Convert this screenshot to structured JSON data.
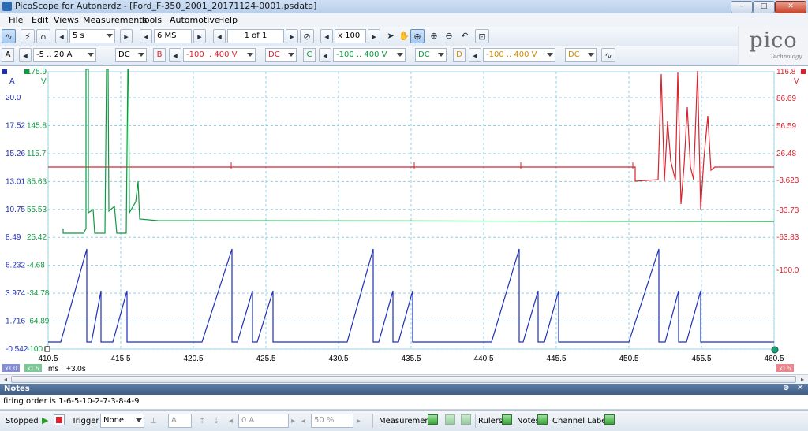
{
  "window": {
    "title": "PicoScope for Autonerdz - [Ford_F-350_2001_20171124-0001.psdata]",
    "controls": [
      "–",
      "□",
      "✕"
    ]
  },
  "menu": [
    {
      "label": "File"
    },
    {
      "label": "Edit"
    },
    {
      "label": "Views"
    },
    {
      "label": "Measurements"
    },
    {
      "label": "Tools"
    },
    {
      "label": "Automotive"
    },
    {
      "label": "Help"
    }
  ],
  "toolbar": {
    "timebase": "5 s",
    "samples": "6 MS",
    "buffer": "1 of 1",
    "zoom": "x 100"
  },
  "channels": [
    {
      "letter": "A",
      "range": "-5 .. 20 A",
      "coupling": "DC",
      "color": "#1f2fb8"
    },
    {
      "letter": "B",
      "range": "-100 .. 400 V",
      "coupling": "DC",
      "color": "#d9232e"
    },
    {
      "letter": "C",
      "range": "-100 .. 400 V",
      "coupling": "DC",
      "color": "#0f9a42"
    },
    {
      "letter": "D",
      "range": "-100 .. 400 V",
      "coupling": "DC",
      "color": "#d08a00"
    }
  ],
  "logo": {
    "word": "pico",
    "sub": "Technology"
  },
  "scope": {
    "axis_a": {
      "unit": "A",
      "ticks": [
        "20.0",
        "17.52",
        "15.26",
        "13.01",
        "10.75",
        "8.49",
        "6.232",
        "3.974",
        "1.716",
        "-0.542"
      ]
    },
    "axis_c": {
      "unit": "V",
      "ticks": [
        "175.9",
        "145.8",
        "115.7",
        "85.63",
        "55.53",
        "25.42",
        "-4.68",
        "-34.78",
        "-64.89",
        "-100.0"
      ]
    },
    "axis_b": {
      "unit": "V",
      "ticks": [
        "116.8",
        "86.69",
        "56.59",
        "26.48",
        "-3.623",
        "-33.73",
        "-63.83",
        "-100.0"
      ]
    },
    "x_ticks": [
      "410.5",
      "415.5",
      "420.5",
      "425.5",
      "430.5",
      "435.5",
      "440.5",
      "445.5",
      "450.5",
      "455.5",
      "460.5"
    ],
    "x_unit": "ms",
    "x_offset": "+3.0s",
    "zoom_badges": [
      "x1.0",
      "x1.5",
      "x1.5"
    ],
    "colors": {
      "a": "#1f2fb8",
      "b": "#d9232e",
      "c": "#0f9a42",
      "grid": "#8fd0e0"
    }
  },
  "notes": {
    "header": "Notes",
    "text": "firing order is 1-6-5-10-2-7-3-8-4-9"
  },
  "statusbar": {
    "state": "Stopped",
    "trigger_label": "Trigger",
    "trigger_mode": "None",
    "trigger_channel": "A",
    "trigger_level": "0 A",
    "trigger_pretrigger": "50 %",
    "measurements": "Measurements",
    "rulers": "Rulers",
    "notes": "Notes",
    "channel_labels": "Channel Labels"
  }
}
